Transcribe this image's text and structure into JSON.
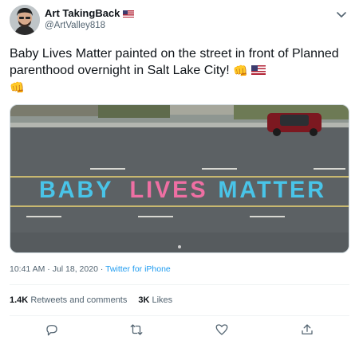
{
  "author": {
    "display_name": "Art TakingBack",
    "handle": "@ArtValley818",
    "name_flag_icon": "us-flag-icon"
  },
  "tweet": {
    "text": "Baby Lives Matter painted on the street in front of Planned parenthood overnight in Salt Lake City!",
    "emoji_1": "👊",
    "emoji_2": "👊",
    "trailing_flag_icon": "us-flag-icon"
  },
  "media": {
    "street_text": {
      "word1": "BABY",
      "word2": "LIVES",
      "word3": "MATTER"
    },
    "colors": {
      "word1": "#49c4e8",
      "word2": "#ef6fa3",
      "word3": "#49c4e8"
    }
  },
  "meta": {
    "time": "10:41 AM · Jul 18, 2020",
    "separator": "·",
    "source": "Twitter for iPhone"
  },
  "stats": {
    "retweets_count": "1.4K",
    "retweets_label": "Retweets and comments",
    "likes_count": "3K",
    "likes_label": "Likes"
  },
  "actions": {
    "reply_icon": "reply-icon",
    "retweet_icon": "retweet-icon",
    "like_icon": "like-icon",
    "share_icon": "share-icon"
  },
  "colors": {
    "link": "#1d9bf0",
    "secondary_text": "#536471"
  }
}
